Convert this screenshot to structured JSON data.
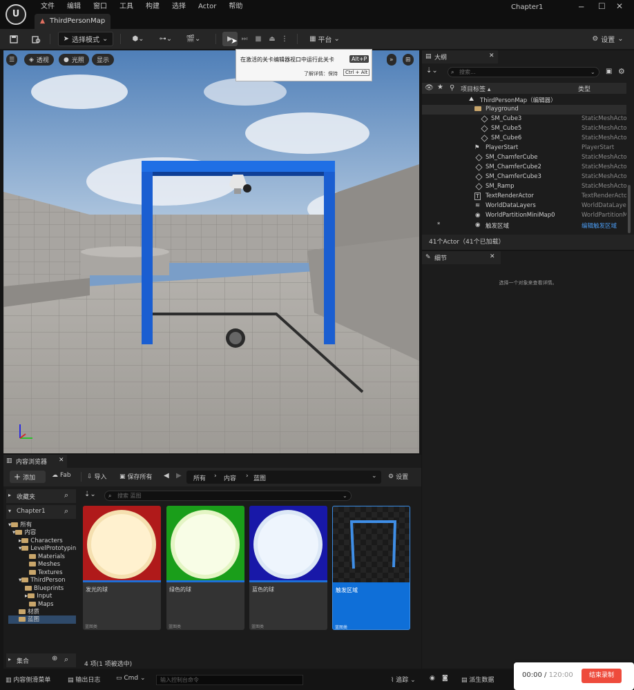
{
  "app": {
    "project_name": "Chapter1",
    "map_tab": "ThirdPersonMap"
  },
  "menubar": [
    "文件",
    "编辑",
    "窗口",
    "工具",
    "构建",
    "选择",
    "Actor",
    "帮助"
  ],
  "toolbar": {
    "mode_label": "选择模式",
    "platform_label": "平台",
    "settings_label": "设置"
  },
  "tooltip": {
    "text": "在激活的关卡编辑器视口中运行此关卡",
    "shortcut": "Alt+P",
    "more_text": "了解详情：保持",
    "more_shortcut": "Ctrl + Alt"
  },
  "viewport": {
    "perspective": "透视",
    "lighting": "光照",
    "show": "显示"
  },
  "outliner": {
    "tab_label": "大纲",
    "search_placeholder": "搜索...",
    "col_label": "项目标签 ▴",
    "col_type": "类型",
    "rows": [
      {
        "label": "ThirdPersonMap（编辑器）",
        "type": ""
      },
      {
        "label": "Playground",
        "type": ""
      },
      {
        "label": "SM_Cube3",
        "type": "StaticMeshActor"
      },
      {
        "label": "SM_Cube5",
        "type": "StaticMeshActor"
      },
      {
        "label": "SM_Cube6",
        "type": "StaticMeshActor"
      },
      {
        "label": "PlayerStart",
        "type": "PlayerStart"
      },
      {
        "label": "SM_ChamferCube",
        "type": "StaticMeshActor"
      },
      {
        "label": "SM_ChamferCube2",
        "type": "StaticMeshActor"
      },
      {
        "label": "SM_ChamferCube3",
        "type": "StaticMeshActor"
      },
      {
        "label": "SM_Ramp",
        "type": "StaticMeshActor"
      },
      {
        "label": "TextRenderActor",
        "type": "TextRenderActor"
      },
      {
        "label": "WorldDataLayers",
        "type": "WorldDataLayers"
      },
      {
        "label": "WorldPartitionMiniMap0",
        "type": "WorldPartitionMiniMap"
      },
      {
        "label": "触发区域",
        "type": "编辑触发区域"
      }
    ],
    "footer": "41个Actor（41个已加载）"
  },
  "details": {
    "tab_label": "细节",
    "empty_text": "选择一个对象来查看详情。"
  },
  "content_browser": {
    "tab_label": "内容浏览器",
    "add_label": "添加",
    "fab_label": "Fab",
    "import_label": "导入",
    "save_all_label": "保存所有",
    "breadcrumb": [
      "所有",
      "内容",
      "蓝图"
    ],
    "settings_label": "设置",
    "favorites_label": "收藏夹",
    "project_label": "Chapter1",
    "filter_placeholder": "搜索 蓝图",
    "tree": [
      "所有",
      "内容",
      "Characters",
      "LevelPrototyping",
      "Materials",
      "Meshes",
      "Textures",
      "ThirdPerson",
      "Blueprints",
      "Input",
      "Maps",
      "材质",
      "蓝图"
    ],
    "collections_label": "集合",
    "assets": [
      {
        "name": "发光的球",
        "class": "蓝图类",
        "color": "#c01818"
      },
      {
        "name": "绿色的球",
        "class": "蓝图类",
        "color": "#1fa81f"
      },
      {
        "name": "蓝色的球",
        "class": "蓝图类",
        "color": "#1a1ab0"
      },
      {
        "name": "触发区域",
        "class": "蓝图类",
        "color": "#1f7fe0"
      }
    ],
    "status": "4 项(1 项被选中)"
  },
  "statusbar": {
    "drawer": "内容侧滑菜单",
    "log": "输出日志",
    "cmd": "Cmd",
    "cmd_placeholder": "输入控制台命令",
    "trace": "追踪",
    "derived": "派生数据"
  },
  "recorder": {
    "elapsed": "00:00",
    "sep": " / ",
    "total": "120:00",
    "stop_label": "结束录制"
  }
}
